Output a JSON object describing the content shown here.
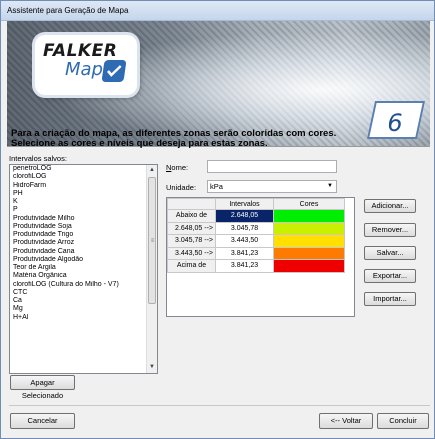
{
  "window": {
    "title": "Assistente para Geração de Mapa"
  },
  "banner": {
    "logo_line1": "FALKER",
    "logo_line2": "Map",
    "step_number": "6"
  },
  "instruction": {
    "line1": "Para a criação do mapa, as diferentes zonas serão coloridas com cores.",
    "line2": "Selecione as cores e níveis que deseja para estas zonas."
  },
  "saved_intervals": {
    "label": "Intervalos salvos:",
    "items": [
      "penetroLOG",
      "clorofiLOG",
      "HidroFarm",
      "PH",
      "K",
      "P",
      "Produtividade Milho",
      "Produtividade Soja",
      "Produtividade Trigo",
      "Produtividade Arroz",
      "Produtividade Cana",
      "Produtividade Algodão",
      "Teor de Argila",
      "Matéria Orgânica",
      "clorofiLOG (Cultura do Milho - V7)",
      "CTC",
      "Ca",
      "Mg",
      "H+Al"
    ],
    "scroll_up_icon": "arrow-up-icon",
    "scroll_down_icon": "arrow-down-icon"
  },
  "form": {
    "name_label": "Nome:",
    "name_value": "",
    "unit_label": "Unidade:",
    "unit_value": "kPa"
  },
  "zones_table": {
    "headers": [
      "",
      "Intervalos",
      "Cores"
    ],
    "rows": [
      {
        "label": "Abaixo de",
        "value": "2.648,05",
        "color": "#00ee00",
        "selected": true
      },
      {
        "label": "2.648,05 -->",
        "value": "3.045,78",
        "color": "#c8f000",
        "selected": false
      },
      {
        "label": "3.045,78 -->",
        "value": "3.443,50",
        "color": "#ffe000",
        "selected": false
      },
      {
        "label": "3.443,50 -->",
        "value": "3.841,23",
        "color": "#ff7a00",
        "selected": false
      },
      {
        "label": "Acima de",
        "value": "3.841,23",
        "color": "#ee0000",
        "selected": false
      }
    ]
  },
  "buttons": {
    "add": "Adicionar...",
    "remove": "Remover...",
    "save": "Salvar...",
    "export": "Exportar...",
    "import": "Importar...",
    "delete_selected": "Apagar Selecionado",
    "cancel": "Cancelar",
    "back": "<-- Voltar",
    "finish": "Concluir"
  }
}
